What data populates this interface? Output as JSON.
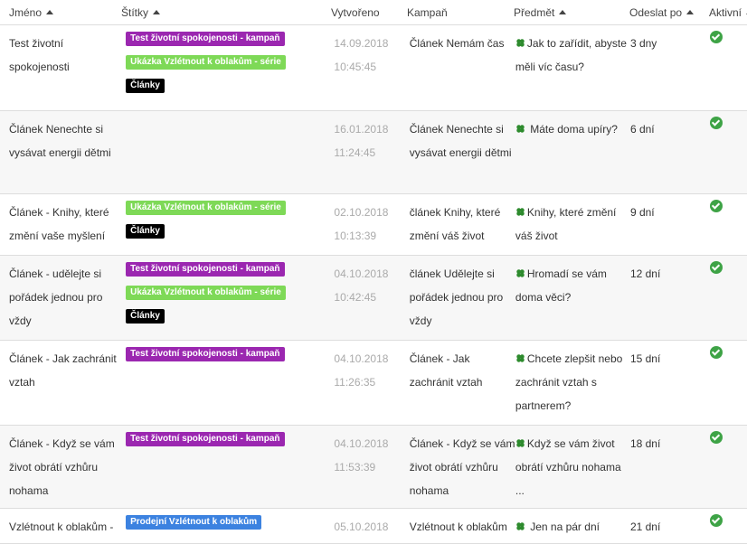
{
  "headers": {
    "name": "Jméno",
    "tags": "Štítky",
    "created": "Vytvořeno",
    "campaign": "Kampaň",
    "subject": "Předmět",
    "send_after": "Odeslat po",
    "active": "Aktivní"
  },
  "colors": {
    "purple": "#9b27b0",
    "green": "#7ed957",
    "black": "#000000",
    "blue": "#3c82e0",
    "check": "#3ea346"
  },
  "rows": [
    {
      "name": "Test životní spokojenosti",
      "tags": [
        "Test životní spokojenosti - kampaň",
        "Ukázka Vzlétnout k oblakům - série",
        "Články"
      ],
      "date": "14.09.2018",
      "time": "10:45:45",
      "campaign": "Článek Nemám čas",
      "subject": "Jak to zařídit, abyste měli víc času?",
      "send_after": "3 dny"
    },
    {
      "name": "Článek Nenechte si vysávat energii dětmi",
      "tags": [],
      "date": "16.01.2018",
      "time": "11:24:45",
      "campaign": "Článek Nenechte si vysávat energii dětmi",
      "subject": " Máte doma upíry?",
      "send_after": "6 dní"
    },
    {
      "name": "Článek - Knihy, které změní vaše myšlení",
      "tags": [
        "Ukázka Vzlétnout k oblakům - série",
        "Články"
      ],
      "date": "02.10.2018",
      "time": "10:13:39",
      "campaign": "článek Knihy, které změní váš život",
      "subject": "Knihy, které změní váš život",
      "send_after": "9 dní"
    },
    {
      "name": "Článek - udělejte si pořádek jednou pro vždy",
      "tags": [
        "Test životní spokojenosti - kampaň",
        "Ukázka Vzlétnout k oblakům - série",
        "Články"
      ],
      "date": "04.10.2018",
      "time": "10:42:45",
      "campaign": "článek Udělejte si pořádek jednou pro vždy",
      "subject": "Hromadí se vám doma věci?",
      "send_after": "12 dní"
    },
    {
      "name": "Článek - Jak zachránit vztah",
      "tags": [
        "Test životní spokojenosti - kampaň"
      ],
      "date": "04.10.2018",
      "time": "11:26:35",
      "campaign": "Článek - Jak zachránit vztah",
      "subject": "Chcete zlepšit nebo zachránit vztah s partnerem?",
      "send_after": "15 dní"
    },
    {
      "name": "Článek - Když se vám život obrátí vzhůru nohama",
      "tags": [
        "Test životní spokojenosti - kampaň"
      ],
      "date": "04.10.2018",
      "time": "11:53:39",
      "campaign": "Článek - Když se vám život obrátí vzhůru nohama",
      "subject": "Když se vám život obrátí vzhůru nohama ...",
      "send_after": "18 dní"
    },
    {
      "name": "Vzlétnout k oblakům -",
      "tags": [
        "Prodejní Vzlétnout k oblakům"
      ],
      "date": "05.10.2018",
      "time": "",
      "campaign": "Vzlétnout k oblakům",
      "subject": " Jen na pár dní",
      "send_after": "21 dní"
    }
  ]
}
